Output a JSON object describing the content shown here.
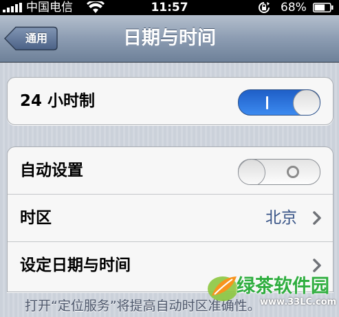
{
  "status_bar": {
    "carrier": "中国电信",
    "time": "11:57",
    "battery_percent": "68%",
    "battery_level": 0.68
  },
  "nav": {
    "back_label": "通用",
    "title": "日期与时间"
  },
  "settings": {
    "hour24": {
      "label": "24 小时制",
      "enabled": true
    },
    "auto_set": {
      "label": "自动设置",
      "enabled": false
    },
    "time_zone": {
      "label": "时区",
      "value": "北京"
    },
    "set_datetime": {
      "label": "设定日期与时间"
    }
  },
  "footer_note": "打开“定位服务”将提高自动时区准确性。",
  "watermark": {
    "name": "绿茶软件园",
    "url": "www.33LC.com"
  },
  "colors": {
    "accent_blue": "#3c8af0",
    "value_text": "#385487",
    "nav_bar": "#8c9cb2"
  }
}
